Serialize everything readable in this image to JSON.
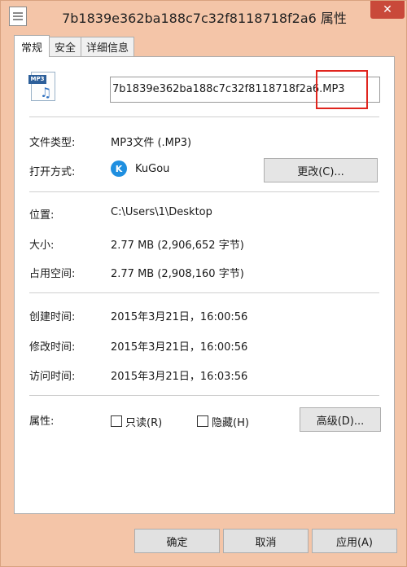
{
  "window": {
    "title": "7b1839e362ba188c7c32f8118718f2a6 属性",
    "close_label": "✕"
  },
  "tabs": [
    {
      "label": "常规",
      "active": true
    },
    {
      "label": "安全",
      "active": false
    },
    {
      "label": "详细信息",
      "active": false
    }
  ],
  "file": {
    "icon_badge": "MP3",
    "name_value": "7b1839e362ba188c7c32f8118718f2a6.MP3"
  },
  "general": {
    "type_label": "文件类型:",
    "type_value": "MP3文件 (.MP3)",
    "opens_label": "打开方式:",
    "opens_app_icon": "K",
    "opens_value": "KuGou",
    "change_button": "更改(C)...",
    "location_label": "位置:",
    "location_value": "C:\\Users\\1\\Desktop",
    "size_label": "大小:",
    "size_value": "2.77 MB (2,906,652 字节)",
    "disk_label": "占用空间:",
    "disk_value": "2.77 MB (2,908,160 字节)",
    "created_label": "创建时间:",
    "created_value": "2015年3月21日，16:00:56",
    "modified_label": "修改时间:",
    "modified_value": "2015年3月21日，16:00:56",
    "accessed_label": "访问时间:",
    "accessed_value": "2015年3月21日，16:03:56",
    "attributes_label": "属性:",
    "readonly_label": "只读(R)",
    "hidden_label": "隐藏(H)",
    "advanced_button": "高级(D)..."
  },
  "footer": {
    "ok": "确定",
    "cancel": "取消",
    "apply": "应用(A)"
  },
  "colors": {
    "frame": "#f4c5a8",
    "close": "#c9493a",
    "highlight_box": "#e0251e"
  }
}
